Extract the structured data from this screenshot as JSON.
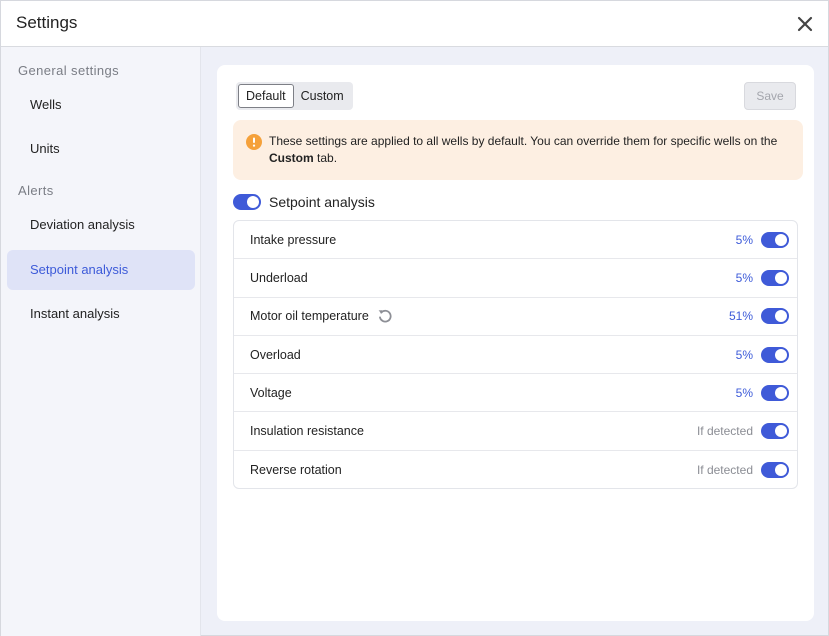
{
  "window": {
    "title": "Settings"
  },
  "sidebar": {
    "sections": [
      {
        "label": "General settings",
        "items": [
          {
            "label": "Wells"
          },
          {
            "label": "Units"
          }
        ]
      },
      {
        "label": "Alerts",
        "items": [
          {
            "label": "Deviation analysis"
          },
          {
            "label": "Setpoint analysis",
            "active": true
          },
          {
            "label": "Instant analysis"
          }
        ]
      }
    ]
  },
  "main": {
    "tabs": [
      {
        "label": "Default",
        "active": true
      },
      {
        "label": "Custom",
        "active": false
      }
    ],
    "save_label": "Save",
    "notice": {
      "text_before": "These settings are applied to all wells by default. You can override them for specific wells on the ",
      "bold": "Custom",
      "text_after": " tab."
    },
    "master_toggle": {
      "label": "Setpoint analysis",
      "on": true
    },
    "rows": [
      {
        "label": "Intake pressure",
        "value": "5%",
        "on": true,
        "reset_icon": false
      },
      {
        "label": "Underload",
        "value": "5%",
        "on": true,
        "reset_icon": false
      },
      {
        "label": "Motor oil temperature",
        "value": "51%",
        "on": true,
        "reset_icon": true
      },
      {
        "label": "Overload",
        "value": "5%",
        "on": true,
        "reset_icon": false
      },
      {
        "label": "Voltage",
        "value": "5%",
        "on": true,
        "reset_icon": false
      },
      {
        "label": "Insulation resistance",
        "value": "If detected",
        "on": true,
        "reset_icon": false
      },
      {
        "label": "Reverse rotation",
        "value": "If detected",
        "on": true,
        "reset_icon": false
      }
    ]
  },
  "colors": {
    "accent": "#3f5ad8",
    "accent_text": "#3d5bd9",
    "warning": "#f5a13b",
    "notice_bg": "#fdefe2",
    "active_nav_bg": "#dfe3f7"
  },
  "icons": {
    "close": "close-icon",
    "warning": "warning-icon",
    "reset": "reset-icon"
  }
}
